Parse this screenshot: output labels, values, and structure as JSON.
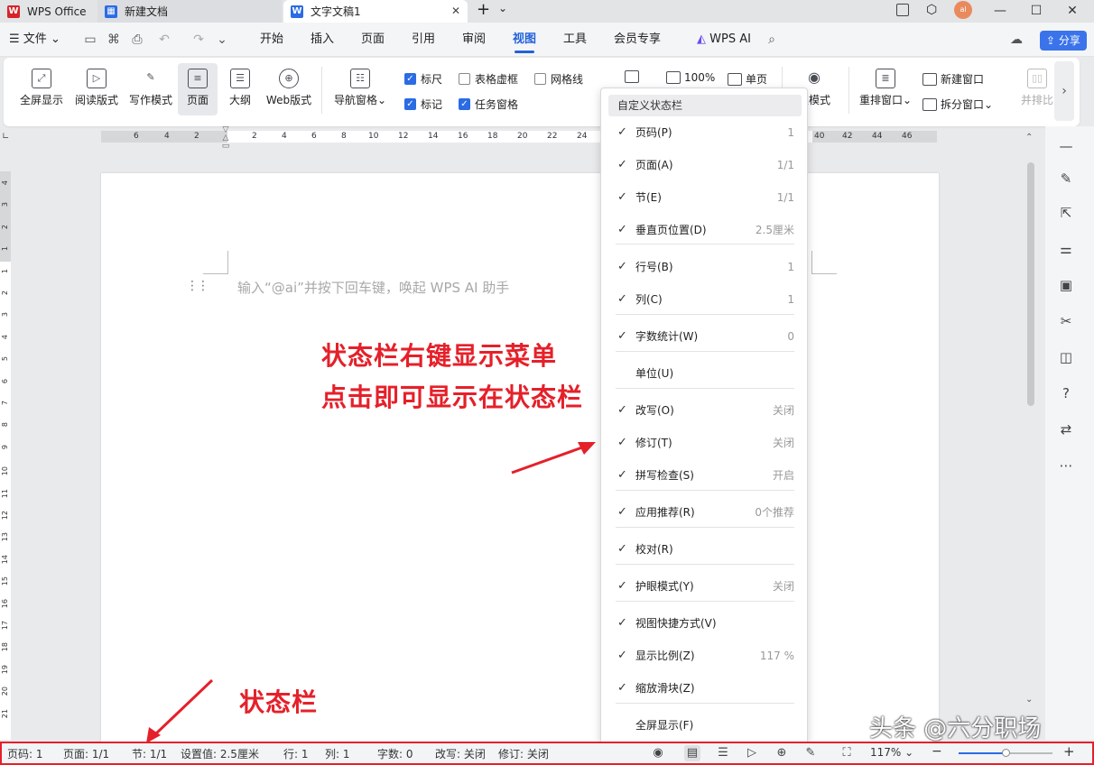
{
  "titlebar": {
    "tabs": [
      {
        "label": "WPS Office"
      },
      {
        "label": "新建文档"
      },
      {
        "label": "文字文稿1"
      }
    ],
    "new_tab": "+",
    "dropdown": "⌄",
    "avatar_text": "al"
  },
  "menubar": {
    "file": "文件",
    "items": [
      "开始",
      "插入",
      "页面",
      "引用",
      "审阅",
      "视图",
      "工具",
      "会员专享"
    ],
    "active": "视图",
    "ai": "WPS AI",
    "share": "分享"
  },
  "ribbon": {
    "buttons": [
      "全屏显示",
      "阅读版式",
      "写作模式",
      "页面",
      "大纲",
      "Web版式",
      "导航窗格"
    ],
    "checks": [
      {
        "label": "标尺",
        "checked": true
      },
      {
        "label": "表格虚框",
        "checked": false
      },
      {
        "label": "网格线",
        "checked": false
      },
      {
        "label": "标记",
        "checked": true
      },
      {
        "label": "任务窗格",
        "checked": true
      }
    ],
    "zoom100": "100%",
    "single_page": "单页",
    "eye_mode": "眼模式",
    "rearrange": "重排窗口",
    "new_window": "新建窗口",
    "split_window": "拆分窗口",
    "side_by_side": "并排比"
  },
  "ruler": {
    "left_numbers": [
      "6",
      "4",
      "2"
    ],
    "right_numbers": [
      "2",
      "4",
      "6",
      "8",
      "10",
      "12",
      "14",
      "16",
      "18",
      "20",
      "22",
      "24"
    ],
    "far_numbers": [
      "40",
      "42",
      "44",
      "46"
    ],
    "vertical_numbers": [
      "4",
      "3",
      "2",
      "1",
      "1",
      "2",
      "3",
      "4",
      "5",
      "6",
      "7",
      "8",
      "9",
      "10",
      "11",
      "12",
      "13",
      "14",
      "15",
      "16",
      "17",
      "18",
      "19",
      "20",
      "21"
    ]
  },
  "document": {
    "placeholder": "输入“@ai”并按下回车键，唤起 WPS AI 助手"
  },
  "annotations": {
    "line1": "状态栏右键显示菜单",
    "line2": "点击即可显示在状态栏",
    "statusbar_label": "状态栏"
  },
  "context_menu": {
    "title": "自定义状态栏",
    "items": [
      {
        "label": "页码(P)",
        "value": "1",
        "checked": true
      },
      {
        "label": "页面(A)",
        "value": "1/1",
        "checked": true
      },
      {
        "label": "节(E)",
        "value": "1/1",
        "checked": true
      },
      {
        "label": "垂直页位置(D)",
        "value": "2.5厘米",
        "checked": true
      },
      {
        "label": "行号(B)",
        "value": "1",
        "checked": true
      },
      {
        "label": "列(C)",
        "value": "1",
        "checked": true
      },
      {
        "label": "字数统计(W)",
        "value": "0",
        "checked": true
      },
      {
        "label": "单位(U)",
        "value": "",
        "checked": false
      },
      {
        "label": "改写(O)",
        "value": "关闭",
        "checked": true
      },
      {
        "label": "修订(T)",
        "value": "关闭",
        "checked": true
      },
      {
        "label": "拼写检查(S)",
        "value": "开启",
        "checked": true
      },
      {
        "label": "应用推荐(R)",
        "value": "0个推荐",
        "checked": true
      },
      {
        "label": "校对(R)",
        "value": "",
        "checked": true
      },
      {
        "label": "护眼模式(Y)",
        "value": "关闭",
        "checked": true
      },
      {
        "label": "视图快捷方式(V)",
        "value": "",
        "checked": true
      },
      {
        "label": "显示比例(Z)",
        "value": "117 %",
        "checked": true
      },
      {
        "label": "缩放滑块(Z)",
        "value": "",
        "checked": true
      },
      {
        "label": "全屏显示(F)",
        "value": "",
        "checked": false
      }
    ]
  },
  "statusbar": {
    "page": "页码: 1",
    "pages": "页面: 1/1",
    "section": "节: 1/1",
    "position": "设置值: 2.5厘米",
    "line": "行: 1",
    "column": "列: 1",
    "words": "字数: 0",
    "overtype": "改写: 关闭",
    "revision": "修订: 关闭",
    "zoom": "117%",
    "zoom_level": 0.5,
    "minus": "−",
    "plus": "+"
  },
  "watermark": "头条 @六分职场",
  "colors": {
    "accent": "#2262d8",
    "annotation": "#e5202a"
  }
}
